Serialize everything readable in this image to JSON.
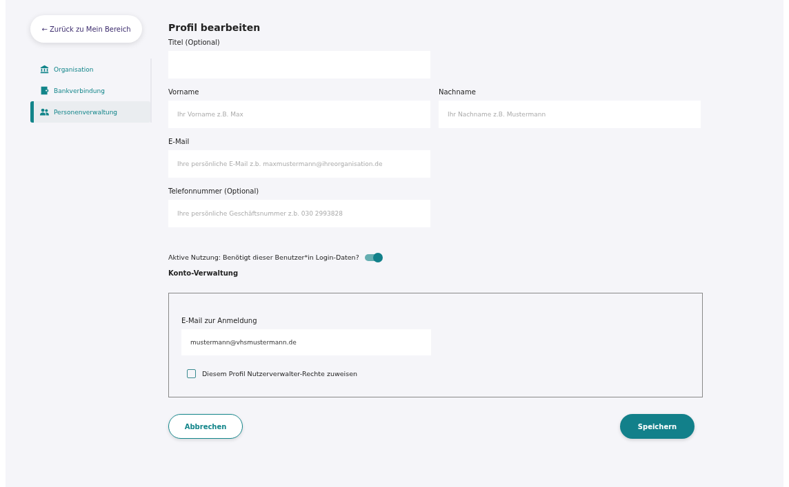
{
  "sidebar": {
    "back_button": "← Zurück zu Mein Bereich",
    "items": [
      {
        "label": "Organisation",
        "selected": false
      },
      {
        "label": "Bankverbindung",
        "selected": false
      },
      {
        "label": "Personenverwaltung",
        "selected": true
      }
    ]
  },
  "form": {
    "title": "Profil bearbeiten",
    "fields": [
      {
        "label": "Titel (Optional)"
      },
      {
        "label": "Vorname",
        "placeholder": "Ihr Vorname z.B. Max"
      },
      {
        "label": "Nachname",
        "placeholder": "Ihr Nachname z.B. Mustermann"
      },
      {
        "label": "E-Mail",
        "placeholder": "Ihre persönliche E-Mail z.b. maxmustermann@ihreorganisation.de"
      },
      {
        "label": "Telefonnummer (Optional)",
        "placeholder": "Ihre persönliche Geschäftsnummer z.b. 030 2993828"
      }
    ],
    "toggle": {
      "label": "Aktive Nutzung: Benötigt dieser Benutzer*in Login-Daten?",
      "on": true
    },
    "account": {
      "heading": "Konto-Verwaltung",
      "login_label": "E-Mail zur Anmeldung",
      "login_value": "mustermann@vhsmustermann.de",
      "checkbox": {
        "label": "Diesem Profil Nutzerverwalter-Rechte zuweisen",
        "checked": false
      }
    },
    "buttons": {
      "cancel": "Abbrechen",
      "save": "Speichern"
    }
  }
}
